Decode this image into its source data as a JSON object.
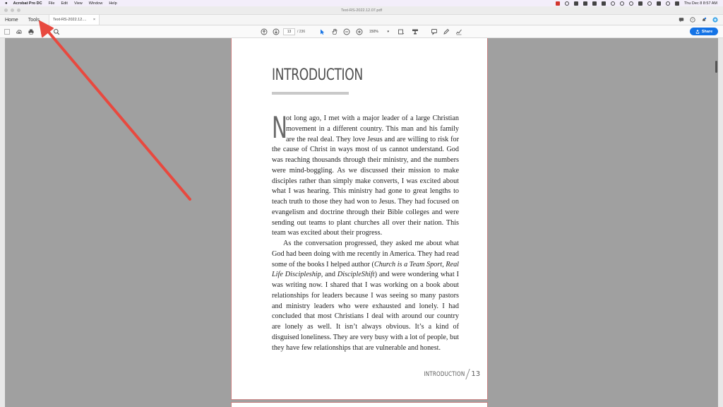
{
  "menubar": {
    "app_name": "Acrobat Pro DC",
    "items": [
      "File",
      "Edit",
      "View",
      "Window",
      "Help"
    ],
    "datetime": "Thu Dec 8  8:57 AM"
  },
  "window": {
    "title": "Text-RS-2022.12.07.pdf"
  },
  "tabs": {
    "home": "Home",
    "tools": "Tools",
    "document_tab": "Text-RS-2022.12....",
    "close": "×"
  },
  "toolbar": {
    "current_page": "13",
    "total_pages": "/ 236",
    "zoom": "150%",
    "share_label": "Share"
  },
  "page": {
    "heading": "INTRODUCTION",
    "drop_cap": "N",
    "paragraph1": "ot long ago, I met with a major leader of a large Christian movement in a different country. This man and his family are the real deal. They love Jesus and are willing to risk for the cause of Christ in ways most of us cannot understand. God was reaching thousands through their ministry, and the numbers were mind-boggling. As we discussed their mission to make disciples rather than simply make converts, I was excited about what I was hearing. This ministry had gone to great lengths to teach truth to those they had won to Jesus. They had focused on evangelism and doctrine through their Bible colleges and were sending out teams to plant churches all over their nation. This team was excited about their progress.",
    "paragraph2_a": "As the conversation progressed, they asked me about what God had been doing with me recently in America. They had read some of the books I helped author (",
    "book1": "Church is a Team Sport",
    "sep1": ", ",
    "book2": "Real Life Discipleship",
    "sep2": ", and ",
    "book3": "DiscipleShift",
    "paragraph2_b": ") and were wondering what I was writing now. I shared that I was working on a book about relationships for leaders because I was seeing so many pastors and ministry leaders who were exhausted and lonely. I had concluded that most Christians I deal with around our country are lonely as well. It isn’t always obvious. It’s a kind of disguised loneliness. They are very busy with a lot of people, but they have few relationships that are vulnerable and honest.",
    "footer_label": "INTRODUCTION",
    "page_number": "13"
  },
  "colors": {
    "share": "#1473e6",
    "arrow": "#e8493f",
    "page_border": "#c98181",
    "doc_background": "#a0a0a0"
  }
}
